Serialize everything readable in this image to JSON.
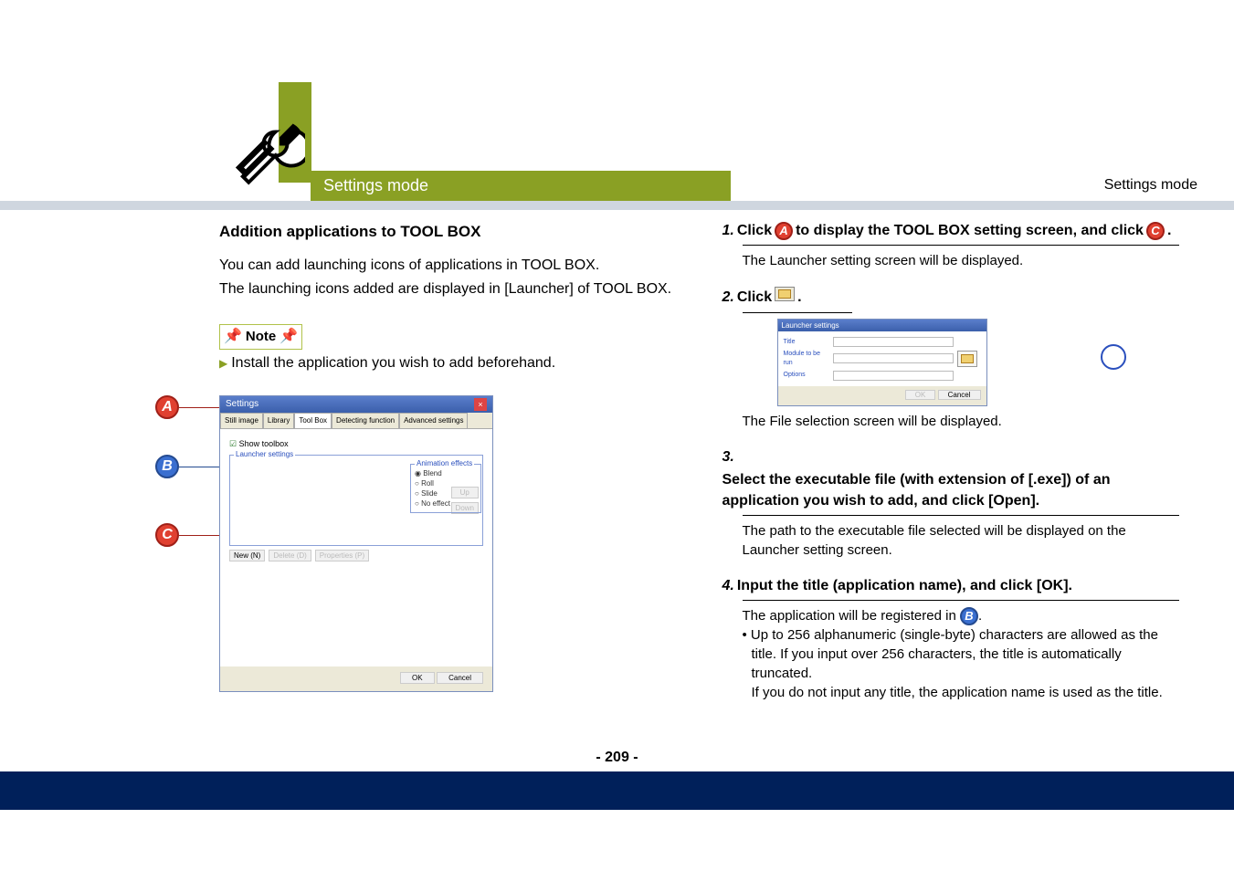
{
  "header": {
    "breadcrumb_right": "Settings mode",
    "green_bar_label": "Settings mode"
  },
  "left": {
    "heading": "Addition applications to TOOL BOX",
    "para1": "You can add launching icons of applications in TOOL BOX.",
    "para2": "The launching icons added are displayed in [Launcher] of TOOL BOX.",
    "note_label": "Note",
    "note_text": "Install the application you wish to add beforehand."
  },
  "settings_dialog": {
    "title": "Settings",
    "tabs": [
      "Still image",
      "Library",
      "Tool Box",
      "Detecting function",
      "Advanced settings"
    ],
    "active_tab_index": 2,
    "show_toolbox": "Show toolbox",
    "launcher_settings_label": "Launcher settings",
    "btn_up": "Up",
    "btn_down": "Down",
    "btn_new": "New (N)",
    "btn_delete": "Delete (D)",
    "btn_properties": "Properties (P)",
    "anim_label": "Animation effects",
    "anim_options": [
      "Blend",
      "Roll",
      "Slide",
      "No effect"
    ],
    "ok": "OK",
    "cancel": "Cancel"
  },
  "markers": {
    "a": "A",
    "b": "B",
    "c": "C"
  },
  "right": {
    "step1_num": "1.",
    "step1_a": "Click",
    "step1_b": "to display the TOOL BOX setting screen, and click",
    "step1_c": ".",
    "step1_body": "The Launcher setting screen will be displayed.",
    "step2_num": "2.",
    "step2_a": "Click",
    "step2_b": ".",
    "step2_body": "The File selection screen will be displayed.",
    "step3_num": "3.",
    "step3_text": "Select the executable file (with extension of [.exe]) of an application you wish to add, and click [Open].",
    "step3_body": "The path to the executable file selected will be displayed on the Launcher setting screen.",
    "step4_num": "4.",
    "step4_text": "Input the title (application name), and click [OK].",
    "step4_body1": "The application will be registered in",
    "step4_body1b": ".",
    "step4_bullet": "• Up to 256 alphanumeric (single-byte) characters are allowed as the title. If you input over 256 characters, the title is automatically truncated.",
    "step4_body2": "If you do not input any title, the application name is used as the title."
  },
  "launcher_dialog": {
    "title": "Launcher settings",
    "lbl_title": "Title",
    "lbl_module": "Module to be run",
    "lbl_options": "Options",
    "ok": "OK",
    "cancel": "Cancel"
  },
  "page_num": "- 209 -"
}
